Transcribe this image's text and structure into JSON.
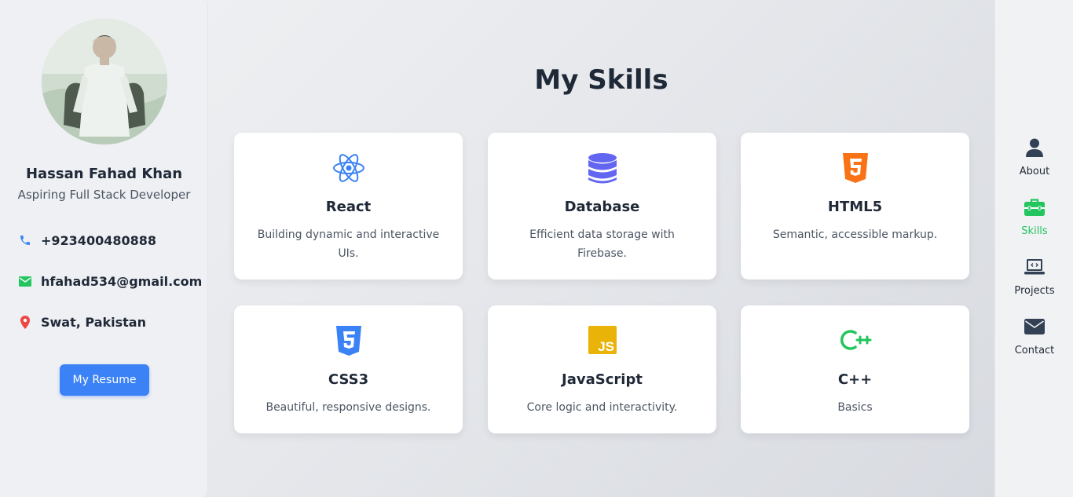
{
  "profile": {
    "name": "Hassan Fahad Khan",
    "role": "Aspiring Full Stack Developer",
    "phone": "+923400480888",
    "email": "hfahad534@gmail.com",
    "location": "Swat, Pakistan",
    "resume_label": "My Resume"
  },
  "skills": {
    "title": "My Skills",
    "items": [
      {
        "name": "React",
        "desc": "Building dynamic and interactive UIs.",
        "icon": "react-icon"
      },
      {
        "name": "Database",
        "desc": "Efficient data storage with Firebase.",
        "icon": "database-icon"
      },
      {
        "name": "HTML5",
        "desc": "Semantic, accessible markup.",
        "icon": "html5-icon"
      },
      {
        "name": "CSS3",
        "desc": "Beautiful, responsive designs.",
        "icon": "css3-icon"
      },
      {
        "name": "JavaScript",
        "desc": "Core logic and interactivity.",
        "icon": "javascript-icon"
      },
      {
        "name": "C++",
        "desc": "Basics",
        "icon": "cplusplus-icon"
      }
    ]
  },
  "nav": {
    "items": [
      {
        "label": "About",
        "icon": "user-icon"
      },
      {
        "label": "Skills",
        "icon": "toolbox-icon",
        "active": true
      },
      {
        "label": "Projects",
        "icon": "laptop-code-icon"
      },
      {
        "label": "Contact",
        "icon": "envelope-icon"
      }
    ]
  },
  "colors": {
    "accent": "#3b82f6",
    "active_nav": "#22c55e",
    "react": "#3b82f6",
    "database": "#6366f1",
    "html5": "#f97316",
    "css3": "#3b82f6",
    "javascript": "#eab308",
    "cplusplus": "#22c55e"
  }
}
